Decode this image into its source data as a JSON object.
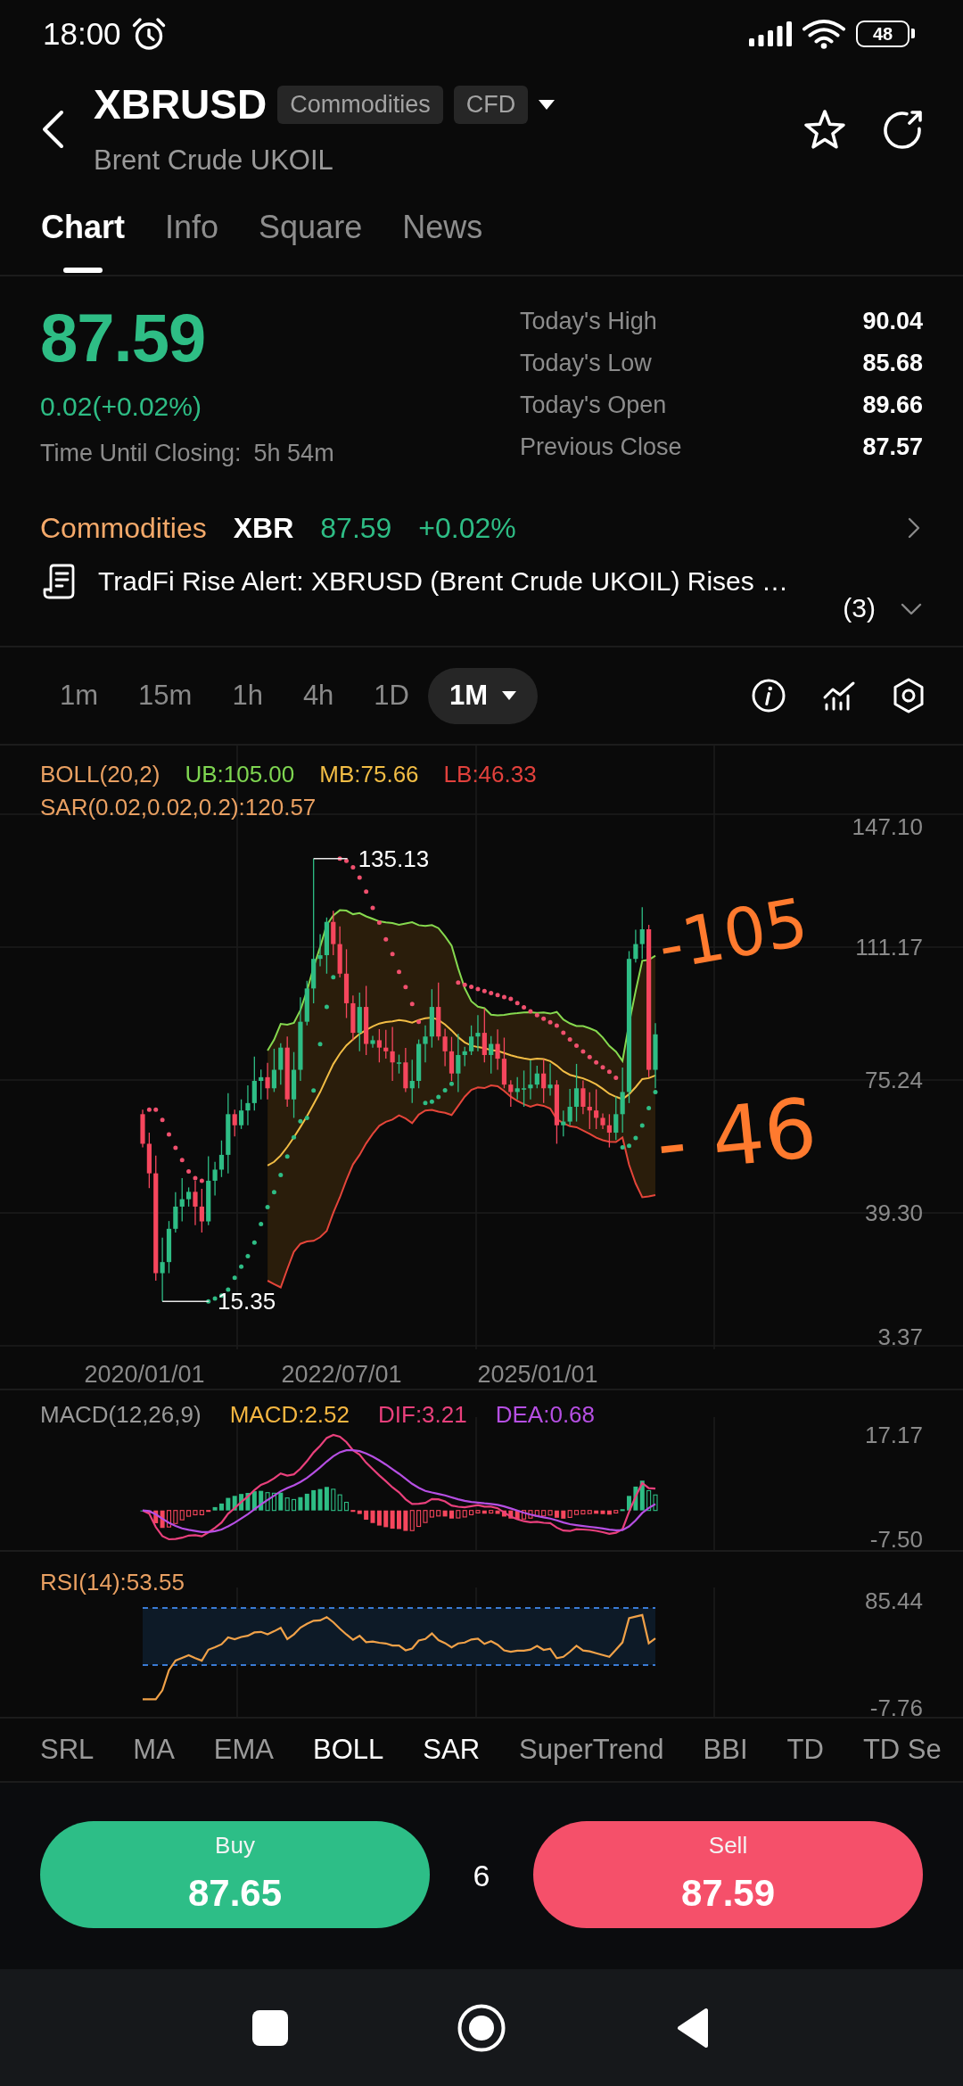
{
  "status_bar": {
    "time": "18:00",
    "battery": "48"
  },
  "header": {
    "symbol": "XBRUSD",
    "badges": [
      "Commodities",
      "CFD"
    ],
    "subtitle": "Brent Crude UKOIL"
  },
  "tabs": [
    {
      "label": "Chart",
      "selected": true
    },
    {
      "label": "Info",
      "selected": false
    },
    {
      "label": "Square",
      "selected": false
    },
    {
      "label": "News",
      "selected": false
    }
  ],
  "quote": {
    "price": "87.59",
    "change": "0.02(+0.02%)",
    "closing_label": "Time Until Closing:",
    "closing_time": "5h 54m",
    "stats": [
      {
        "label": "Today's High",
        "value": "90.04"
      },
      {
        "label": "Today's Low",
        "value": "85.68"
      },
      {
        "label": "Today's Open",
        "value": "89.66"
      },
      {
        "label": "Previous Close",
        "value": "87.57"
      }
    ]
  },
  "market_row": {
    "category": "Commodities",
    "symbol": "XBR",
    "price": "87.59",
    "change": "+0.02%"
  },
  "alert": {
    "text": "TradFi Rise Alert: XBRUSD (Brent Crude UKOIL) Rises …",
    "count": "(3)"
  },
  "intervals": [
    {
      "label": "1m",
      "selected": false
    },
    {
      "label": "15m",
      "selected": false
    },
    {
      "label": "1h",
      "selected": false
    },
    {
      "label": "4h",
      "selected": false
    },
    {
      "label": "1D",
      "selected": false
    },
    {
      "label": "1M",
      "selected": true
    }
  ],
  "price_chart": {
    "legend": [
      [
        {
          "text": "BOLL(20,2)",
          "color": "#e9a062"
        },
        {
          "text": "UB:105.00",
          "color": "#7fd651"
        },
        {
          "text": "MB:75.66",
          "color": "#f2bd45"
        },
        {
          "text": "LB:46.33",
          "color": "#e2413c"
        }
      ],
      [
        {
          "text": "SAR(0.02,0.02,0.2):120.57",
          "color": "#e9a062"
        }
      ]
    ],
    "y_labels": [
      "147.10",
      "111.17",
      "75.24",
      "39.30",
      "3.37"
    ],
    "x_labels": [
      "2020/01/01",
      "2022/07/01",
      "2025/01/01"
    ],
    "high_label": "135.13",
    "low_label": "15.35",
    "annotations": [
      "-105",
      "- 46"
    ]
  },
  "macd_chart": {
    "legend": [
      {
        "text": "MACD(12,26,9)",
        "color": "#9a9a9a"
      },
      {
        "text": "MACD:2.52",
        "color": "#f5b641"
      },
      {
        "text": "DIF:3.21",
        "color": "#e9407c"
      },
      {
        "text": "DEA:0.68",
        "color": "#b64fe3"
      }
    ],
    "y_labels": [
      "17.17",
      "-7.50"
    ]
  },
  "rsi_chart": {
    "legend": "RSI(14):53.55",
    "y_labels": [
      "85.44",
      "-7.76"
    ]
  },
  "indicators": [
    {
      "label": "SRL",
      "selected": false
    },
    {
      "label": "MA",
      "selected": false
    },
    {
      "label": "EMA",
      "selected": false
    },
    {
      "label": "BOLL",
      "selected": true
    },
    {
      "label": "SAR",
      "selected": true
    },
    {
      "label": "SuperTrend",
      "selected": false
    },
    {
      "label": "BBI",
      "selected": false
    },
    {
      "label": "TD",
      "selected": false
    },
    {
      "label": "TD Se",
      "selected": false
    }
  ],
  "trade": {
    "buy": {
      "label": "Buy",
      "price": "87.65"
    },
    "spread": "6",
    "sell": {
      "label": "Sell",
      "price": "87.59"
    }
  }
}
